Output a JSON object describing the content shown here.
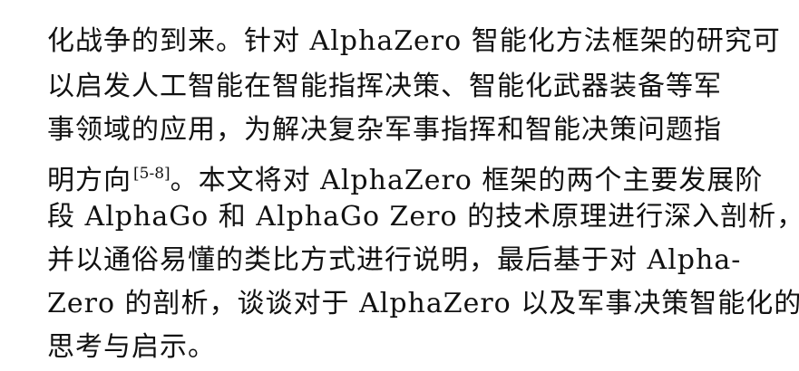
{
  "document": {
    "lines": [
      "化战争的到来。针对 AlphaZero 智能化方法框架的研究可",
      "以启发人工智能在智能指挥决策、智能化武器装备等军",
      "事领域的应用，为解决复杂军事指挥和智能决策问题指",
      "。本文将对 AlphaZero 框架的两个主要发展阶",
      "段 AlphaGo 和 AlphaGo Zero 的技术原理进行深入剖析，",
      "并以通俗易懂的类比方式进行说明，最后基于对 Alpha-",
      "Zero 的剖析，谈谈对于 AlphaZero 以及军事决策智能化的",
      "思考与启示。"
    ],
    "line3_prefix": "明方向",
    "citation": "[5-8]"
  }
}
